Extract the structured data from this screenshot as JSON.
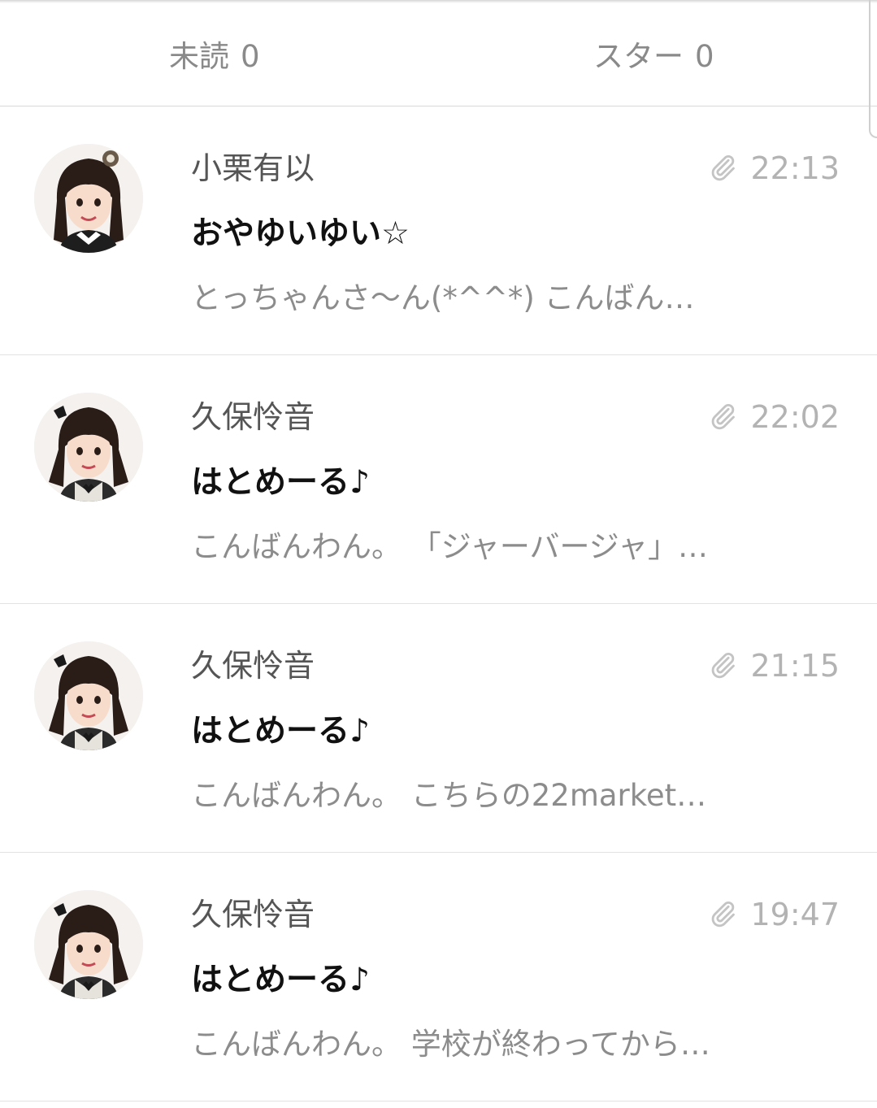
{
  "tabs": [
    {
      "label": "未読",
      "count": "0"
    },
    {
      "label": "スター",
      "count": "0"
    }
  ],
  "messages": [
    {
      "sender": "小栗有以",
      "time": "22:13",
      "subject": "おやゆいゆい☆",
      "preview": "とっちゃんさ〜ん(*^^*) こんばん…",
      "has_attachment": true
    },
    {
      "sender": "久保怜音",
      "time": "22:02",
      "subject": "はとめーる♪",
      "preview": "こんばんわん。 「ジャーバージャ」…",
      "has_attachment": true
    },
    {
      "sender": "久保怜音",
      "time": "21:15",
      "subject": "はとめーる♪",
      "preview": "こんばんわん。 こちらの22market…",
      "has_attachment": true
    },
    {
      "sender": "久保怜音",
      "time": "19:47",
      "subject": "はとめーる♪",
      "preview": "こんばんわん。 学校が終わってから…",
      "has_attachment": true
    }
  ],
  "icons": {
    "attachment": "paperclip-icon",
    "avatar": "avatar-photo"
  },
  "colors": {
    "time": "#b3b3b3",
    "sender": "#555555",
    "preview": "#8c8c8c",
    "subject": "#111111",
    "divider": "#e2e2e2"
  }
}
